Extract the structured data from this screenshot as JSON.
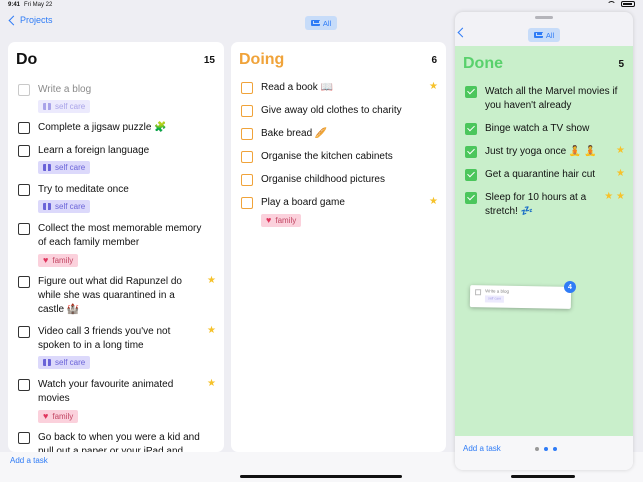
{
  "status": {
    "time": "9:41",
    "date": "Fri May 22"
  },
  "nav": {
    "back_label": "Projects",
    "filter_label": "All"
  },
  "columns": [
    {
      "title": "Do",
      "count": "15",
      "color": "#111111",
      "items": [
        {
          "text": "Write a blog",
          "tag": "self care",
          "faded": true
        },
        {
          "text": "Complete a jigsaw puzzle 🧩"
        },
        {
          "text": "Learn a foreign language",
          "tag": "self care"
        },
        {
          "text": "Try to meditate once",
          "tag": "self care"
        },
        {
          "text": "Collect the most memorable memory of each family member",
          "tag": "family"
        },
        {
          "text": "Figure out what did Rapunzel do while she was quarantined in a castle 🏰",
          "star": "★"
        },
        {
          "text": "Video call 3 friends you've not spoken to in a long time",
          "tag": "self care",
          "star": "★"
        },
        {
          "text": "Watch your favourite animated movies",
          "tag": "family",
          "star": "★"
        },
        {
          "text": "Go back to when you were a kid and pull out a paper or your iPad and draw"
        }
      ]
    },
    {
      "title": "Doing",
      "count": "6",
      "color": "#f0a33a",
      "items": [
        {
          "text": "Read a book 📖",
          "star": "★"
        },
        {
          "text": "Give away old clothes to charity"
        },
        {
          "text": "Bake bread 🥖"
        },
        {
          "text": "Organise the kitchen cabinets"
        },
        {
          "text": "Organise childhood pictures"
        },
        {
          "text": "Play a board game",
          "tag": "family",
          "star": "★"
        }
      ]
    }
  ],
  "done": {
    "title": "Done",
    "count": "5",
    "color": "#59d16c",
    "items": [
      {
        "text": "Watch all the Marvel movies if you haven't already"
      },
      {
        "text": "Binge watch a TV show"
      },
      {
        "text": "Just try yoga once 🧘 🧘",
        "star": "★"
      },
      {
        "text": "Get a quarantine hair cut",
        "star": "★"
      },
      {
        "text": "Sleep for 10 hours at a stretch! 💤",
        "star": "★ ★"
      }
    ]
  },
  "drag_preview": {
    "text": "Write a blog",
    "tag": "self care",
    "badge": "4"
  },
  "bottom": {
    "add_task_label": "Add a task"
  },
  "panel_bottom": {
    "add_task_label": "Add a task"
  }
}
